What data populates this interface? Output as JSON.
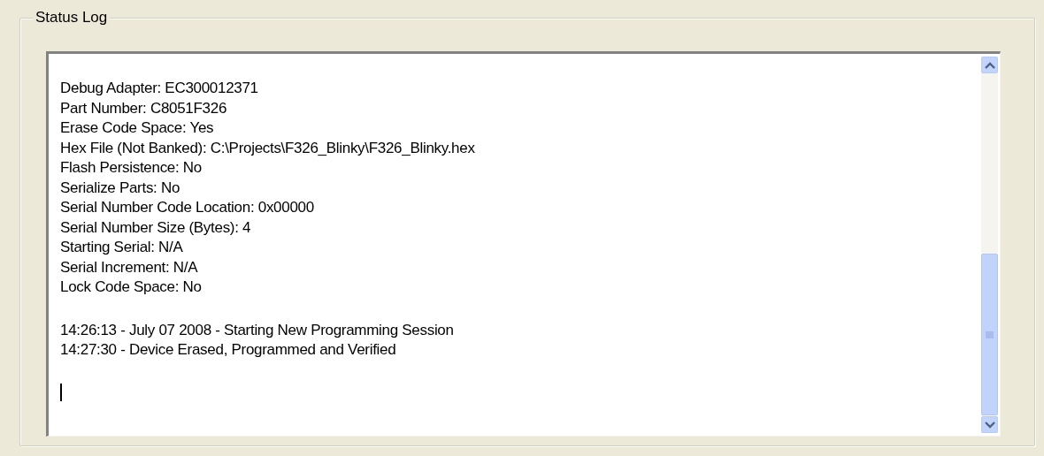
{
  "group": {
    "title": "Status Log"
  },
  "log": {
    "blocks": [
      [
        "Debug Adapter: EC300012371",
        "Part Number: C8051F326",
        "Erase Code Space: Yes",
        "Hex File (Not Banked): C:\\Projects\\F326_Blinky\\F326_Blinky.hex",
        "Flash Persistence: No",
        "Serialize Parts: No",
        "Serial Number Code Location: 0x00000",
        "Serial Number Size (Bytes): 4",
        "Starting Serial: N/A",
        "Serial Increment: N/A",
        "Lock Code Space: No"
      ],
      [
        "14:26:13 - July 07 2008 - Starting New Programming Session",
        "14:27:30 - Device Erased, Programmed and Verified"
      ]
    ]
  }
}
